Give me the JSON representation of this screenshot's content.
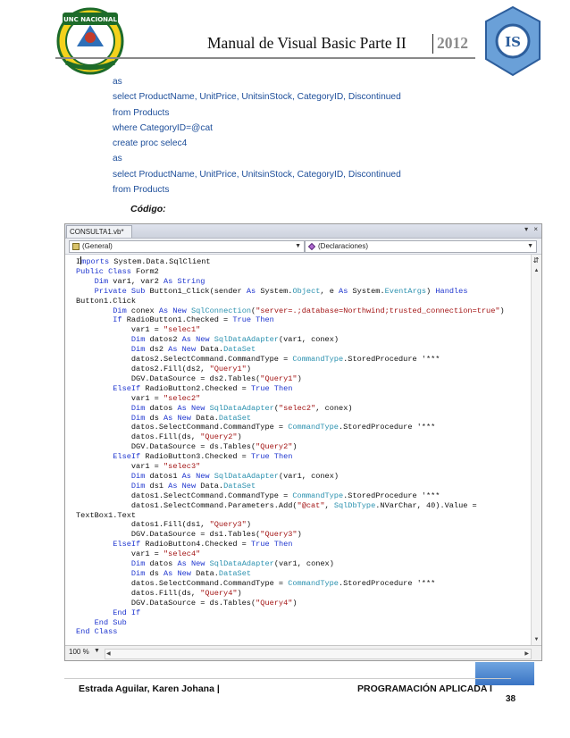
{
  "header": {
    "title": "Manual de Visual Basic  Parte II",
    "year": "2012",
    "left_logo_text": "UNC NACIONAL",
    "left_logo_ring_text": "UNIVERSIDAD NACIONAL DE CAJAMARCA",
    "left_logo_band_text": "Norte de la Universidad Peruana",
    "right_logo_text": "IS"
  },
  "sql_lines": [
    "as",
    "select ProductName, UnitPrice, UnitsinStock, CategoryID, Discontinued",
    "from Products",
    "where CategoryID=@cat",
    "create proc selec4",
    "as",
    "select ProductName, UnitPrice, UnitsinStock, CategoryID, Discontinued",
    "from Products"
  ],
  "codigo_label": "Código:",
  "editor": {
    "tab_title": "CONSULTA1.vb*",
    "tab_controls": "▾ ×",
    "dropdown_left": "(General)",
    "dropdown_right": "(Declaraciones)",
    "zoom": "100 %",
    "split_button": "⇵"
  },
  "footer": {
    "left": "Estrada Aguilar, Karen Johana |",
    "right": "PROGRAMACIÓN APLICADA I",
    "page": "38"
  },
  "code_lines": [
    [
      [
        "",
        "I"
      ],
      [
        "cursor",
        ""
      ],
      [
        "kw",
        "mports"
      ],
      [
        "",
        ""
      ],
      [
        "",
        ""
      ],
      [
        "",
        " System.Data.SqlClient"
      ]
    ],
    [
      [
        "kw",
        "Public Class"
      ],
      [
        "",
        " Form2"
      ]
    ],
    [
      [
        "",
        "    "
      ],
      [
        "kw",
        "Dim"
      ],
      [
        "",
        " var1, var2 "
      ],
      [
        "kw",
        "As String"
      ]
    ],
    [
      [
        "",
        "    "
      ],
      [
        "kw",
        "Private Sub"
      ],
      [
        "",
        " Button1_Click(sender "
      ],
      [
        "kw",
        "As"
      ],
      [
        "",
        " System."
      ],
      [
        "ty",
        "Object"
      ],
      [
        "",
        ", e "
      ],
      [
        "kw",
        "As"
      ],
      [
        "",
        " System."
      ],
      [
        "ty",
        "EventArgs"
      ],
      [
        "",
        ") "
      ],
      [
        "kw",
        "Handles"
      ]
    ],
    [
      [
        "",
        "Button1.Click"
      ]
    ],
    [
      [
        "",
        "        "
      ],
      [
        "kw",
        "Dim"
      ],
      [
        "",
        " conex "
      ],
      [
        "kw",
        "As New"
      ],
      [
        "",
        " "
      ],
      [
        "ty",
        "SqlConnection"
      ],
      [
        "",
        "("
      ],
      [
        "st",
        "\"server=.;database=Northwind;trusted_connection=true\""
      ],
      [
        "",
        ")"
      ]
    ],
    [
      [
        "",
        "        "
      ],
      [
        "kw",
        "If"
      ],
      [
        "",
        " RadioButton1.Checked = "
      ],
      [
        "kw",
        "True Then"
      ]
    ],
    [
      [
        "",
        "            var1 = "
      ],
      [
        "st",
        "\"selec1\""
      ]
    ],
    [
      [
        "",
        "            "
      ],
      [
        "kw",
        "Dim"
      ],
      [
        "",
        " datos2 "
      ],
      [
        "kw",
        "As New"
      ],
      [
        "",
        " "
      ],
      [
        "ty",
        "SqlDataAdapter"
      ],
      [
        "",
        "(var1, conex)"
      ]
    ],
    [
      [
        "",
        "            "
      ],
      [
        "kw",
        "Dim"
      ],
      [
        "",
        " ds2 "
      ],
      [
        "kw",
        "As New"
      ],
      [
        "",
        " Data."
      ],
      [
        "ty",
        "DataSet"
      ]
    ],
    [
      [
        "",
        "            datos2.SelectCommand.CommandType = "
      ],
      [
        "ty",
        "CommandType"
      ],
      [
        "",
        ".StoredProcedure '***"
      ]
    ],
    [
      [
        "",
        "            datos2.Fill(ds2, "
      ],
      [
        "st",
        "\"Query1\""
      ],
      [
        "",
        ")"
      ]
    ],
    [
      [
        "",
        "            DGV.DataSource = ds2.Tables("
      ],
      [
        "st",
        "\"Query1\""
      ],
      [
        "",
        ")"
      ]
    ],
    [
      [
        "",
        "        "
      ],
      [
        "kw",
        "ElseIf"
      ],
      [
        "",
        " RadioButton2.Checked = "
      ],
      [
        "kw",
        "True Then"
      ]
    ],
    [
      [
        "",
        "            var1 = "
      ],
      [
        "st",
        "\"selec2\""
      ]
    ],
    [
      [
        "",
        "            "
      ],
      [
        "kw",
        "Dim"
      ],
      [
        "",
        " datos "
      ],
      [
        "kw",
        "As New"
      ],
      [
        "",
        " "
      ],
      [
        "ty",
        "SqlDataAdapter"
      ],
      [
        "",
        "("
      ],
      [
        "st",
        "\"selec2\""
      ],
      [
        "",
        ", conex)"
      ]
    ],
    [
      [
        "",
        "            "
      ],
      [
        "kw",
        "Dim"
      ],
      [
        "",
        " ds "
      ],
      [
        "kw",
        "As New"
      ],
      [
        "",
        " Data."
      ],
      [
        "ty",
        "DataSet"
      ]
    ],
    [
      [
        "",
        "            datos.SelectCommand.CommandType = "
      ],
      [
        "ty",
        "CommandType"
      ],
      [
        "",
        ".StoredProcedure '***"
      ]
    ],
    [
      [
        "",
        "            datos.Fill(ds, "
      ],
      [
        "st",
        "\"Query2\""
      ],
      [
        "",
        ")"
      ]
    ],
    [
      [
        "",
        "            DGV.DataSource = ds.Tables("
      ],
      [
        "st",
        "\"Query2\""
      ],
      [
        "",
        ")"
      ]
    ],
    [
      [
        "",
        "        "
      ],
      [
        "kw",
        "ElseIf"
      ],
      [
        "",
        " RadioButton3.Checked = "
      ],
      [
        "kw",
        "True Then"
      ]
    ],
    [
      [
        "",
        "            var1 = "
      ],
      [
        "st",
        "\"selec3\""
      ]
    ],
    [
      [
        "",
        "            "
      ],
      [
        "kw",
        "Dim"
      ],
      [
        "",
        " datos1 "
      ],
      [
        "kw",
        "As New"
      ],
      [
        "",
        " "
      ],
      [
        "ty",
        "SqlDataAdapter"
      ],
      [
        "",
        "(var1, conex)"
      ]
    ],
    [
      [
        "",
        "            "
      ],
      [
        "kw",
        "Dim"
      ],
      [
        "",
        " ds1 "
      ],
      [
        "kw",
        "As New"
      ],
      [
        "",
        " Data."
      ],
      [
        "ty",
        "DataSet"
      ]
    ],
    [
      [
        "",
        "            datos1.SelectCommand.CommandType = "
      ],
      [
        "ty",
        "CommandType"
      ],
      [
        "",
        ".StoredProcedure '***"
      ]
    ],
    [
      [
        "",
        "            datos1.SelectCommand.Parameters.Add("
      ],
      [
        "st",
        "\"@cat\""
      ],
      [
        "",
        ", "
      ],
      [
        "ty",
        "SqlDbType"
      ],
      [
        "",
        ".NVarChar, 40).Value ="
      ]
    ],
    [
      [
        "",
        "TextBox1.Text"
      ]
    ],
    [
      [
        "",
        "            datos1.Fill(ds1, "
      ],
      [
        "st",
        "\"Query3\""
      ],
      [
        "",
        ")"
      ]
    ],
    [
      [
        "",
        "            DGV.DataSource = ds1.Tables("
      ],
      [
        "st",
        "\"Query3\""
      ],
      [
        "",
        ")"
      ]
    ],
    [
      [
        "",
        "        "
      ],
      [
        "kw",
        "ElseIf"
      ],
      [
        "",
        " RadioButton4.Checked = "
      ],
      [
        "kw",
        "True Then"
      ]
    ],
    [
      [
        "",
        "            var1 = "
      ],
      [
        "st",
        "\"selec4\""
      ]
    ],
    [
      [
        "",
        "            "
      ],
      [
        "kw",
        "Dim"
      ],
      [
        "",
        " datos "
      ],
      [
        "kw",
        "As New"
      ],
      [
        "",
        " "
      ],
      [
        "ty",
        "SqlDataAdapter"
      ],
      [
        "",
        "(var1, conex)"
      ]
    ],
    [
      [
        "",
        "            "
      ],
      [
        "kw",
        "Dim"
      ],
      [
        "",
        " ds "
      ],
      [
        "kw",
        "As New"
      ],
      [
        "",
        " Data."
      ],
      [
        "ty",
        "DataSet"
      ]
    ],
    [
      [
        "",
        "            datos.SelectCommand.CommandType = "
      ],
      [
        "ty",
        "CommandType"
      ],
      [
        "",
        ".StoredProcedure '***"
      ]
    ],
    [
      [
        "",
        "            datos.Fill(ds, "
      ],
      [
        "st",
        "\"Query4\""
      ],
      [
        "",
        ")"
      ]
    ],
    [
      [
        "",
        "            DGV.DataSource = ds.Tables("
      ],
      [
        "st",
        "\"Query4\""
      ],
      [
        "",
        ")"
      ]
    ],
    [
      [
        "",
        "        "
      ],
      [
        "kw",
        "End If"
      ]
    ],
    [
      [
        "",
        "    "
      ],
      [
        "kw",
        "End Sub"
      ]
    ],
    [
      [
        "kw",
        "End Class"
      ]
    ]
  ]
}
